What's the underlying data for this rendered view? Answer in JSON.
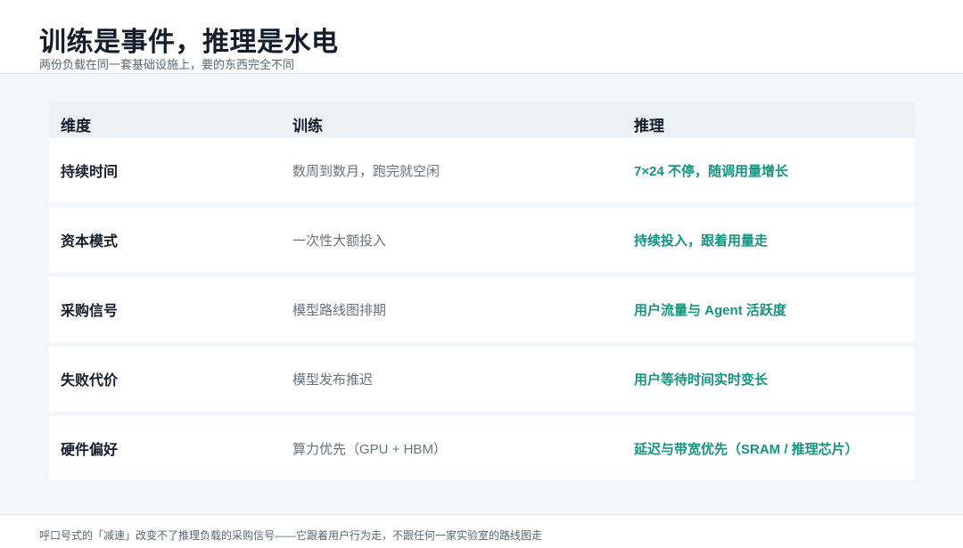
{
  "header": {
    "title": "训练是事件，推理是水电",
    "subtitle": "两份负载在同一套基础设施上，要的东西完全不同"
  },
  "table": {
    "columns": [
      "维度",
      "训练",
      "推理"
    ],
    "rows": [
      {
        "dimension": "持续时间",
        "training": "数周到数月，跑完就空闲",
        "inference": "7×24 不停，随调用量增长"
      },
      {
        "dimension": "资本模式",
        "training": "一次性大额投入",
        "inference": "持续投入，跟着用量走"
      },
      {
        "dimension": "采购信号",
        "training": "模型路线图排期",
        "inference": "用户流量与 Agent 活跃度"
      },
      {
        "dimension": "失败代价",
        "training": "模型发布推迟",
        "inference": "用户等待时间实时变长"
      },
      {
        "dimension": "硬件偏好",
        "training": "算力优先（GPU + HBM）",
        "inference": "延迟与带宽优先（SRAM / 推理芯片）"
      }
    ]
  },
  "footer": {
    "note": "呼口号式的「减速」改变不了推理负载的采购信号——它跟着用户行为走，不跟任何一家实验室的路线图走"
  },
  "colors": {
    "accent": "#15957f",
    "title": "#141d2b",
    "muted": "#6a737d",
    "background": "#f3f7fb"
  }
}
